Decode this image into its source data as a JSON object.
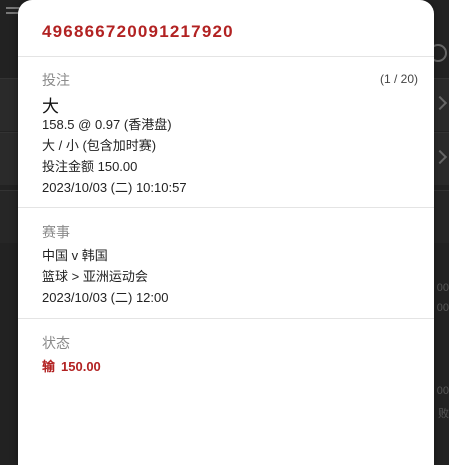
{
  "background": {
    "row_texts": [
      "00",
      "00",
      "00",
      "败"
    ]
  },
  "bet": {
    "id": "496866720091217920",
    "counter": "(1 / 20)",
    "section_label": "投注",
    "selection": "大",
    "odds_line": "158.5 @ 0.97 (香港盘)",
    "market": "大 / 小 (包含加时赛)",
    "stake_line": "投注金额 150.00",
    "placed_time": "2023/10/03 (二) 10:10:57"
  },
  "event": {
    "section_label": "赛事",
    "teams": "中国 v 韩国",
    "competition": "篮球 > 亚洲运动会",
    "start_time": "2023/10/03 (二) 12:00"
  },
  "status": {
    "section_label": "状态",
    "result": "输",
    "amount": "150.00"
  },
  "colors": {
    "accent": "#b22222",
    "muted": "#8a8a8a"
  }
}
